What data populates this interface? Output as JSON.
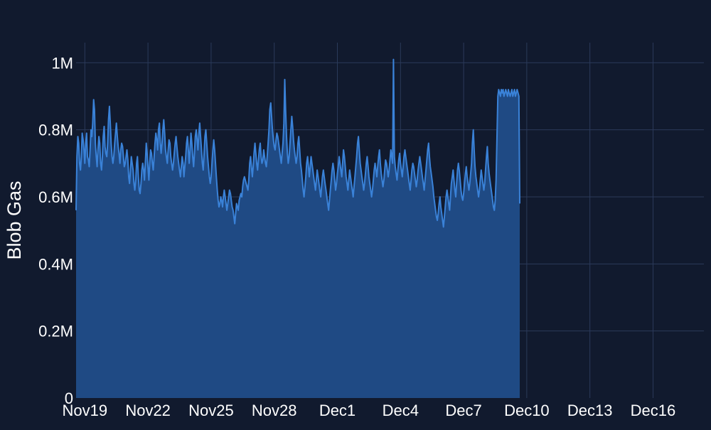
{
  "chart_data": {
    "type": "area",
    "title": "",
    "xlabel": "",
    "ylabel": "Blob Gas",
    "x_tick_labels": [
      "Nov19",
      "Nov22",
      "Nov25",
      "Nov28",
      "Dec1",
      "Dec4",
      "Dec7",
      "Dec10",
      "Dec13",
      "Dec16"
    ],
    "y_tick_labels": [
      "0",
      "0.2M",
      "0.4M",
      "0.6M",
      "0.8M",
      "1M"
    ],
    "y_ticks": [
      0,
      200000,
      400000,
      600000,
      800000,
      1000000
    ],
    "xlim": [
      "Nov18 14:00",
      "Dec18 10:00"
    ],
    "ylim": [
      0,
      1060000
    ],
    "grid": true,
    "colors": {
      "background": "#111a2e",
      "grid": "#2b3a5a",
      "line": "#3a82d8",
      "fill": "#1f4a84"
    },
    "series": [
      {
        "x_start": "Nov18 14:00",
        "x_step_hours": 1,
        "values": [
          560000,
          720000,
          780000,
          760000,
          700000,
          680000,
          720000,
          790000,
          770000,
          740000,
          700000,
          760000,
          790000,
          720000,
          710000,
          690000,
          740000,
          800000,
          780000,
          820000,
          890000,
          860000,
          760000,
          720000,
          690000,
          740000,
          780000,
          760000,
          700000,
          680000,
          720000,
          780000,
          810000,
          750000,
          730000,
          720000,
          760000,
          830000,
          870000,
          820000,
          760000,
          720000,
          700000,
          720000,
          760000,
          790000,
          820000,
          780000,
          750000,
          730000,
          700000,
          740000,
          760000,
          750000,
          720000,
          690000,
          700000,
          720000,
          740000,
          710000,
          660000,
          640000,
          680000,
          720000,
          700000,
          680000,
          640000,
          620000,
          650000,
          700000,
          720000,
          660000,
          620000,
          610000,
          640000,
          680000,
          700000,
          680000,
          650000,
          700000,
          760000,
          730000,
          690000,
          650000,
          700000,
          740000,
          730000,
          700000,
          680000,
          720000,
          760000,
          790000,
          770000,
          740000,
          800000,
          820000,
          760000,
          730000,
          760000,
          800000,
          830000,
          790000,
          740000,
          720000,
          700000,
          740000,
          770000,
          760000,
          720000,
          700000,
          680000,
          700000,
          730000,
          760000,
          780000,
          750000,
          720000,
          700000,
          680000,
          660000,
          690000,
          720000,
          700000,
          660000,
          690000,
          720000,
          760000,
          780000,
          740000,
          700000,
          740000,
          790000,
          760000,
          720000,
          690000,
          730000,
          780000,
          800000,
          770000,
          740000,
          790000,
          820000,
          780000,
          740000,
          700000,
          680000,
          730000,
          780000,
          800000,
          760000,
          720000,
          690000,
          660000,
          640000,
          660000,
          700000,
          740000,
          770000,
          740000,
          700000,
          660000,
          620000,
          590000,
          570000,
          580000,
          600000,
          590000,
          570000,
          600000,
          620000,
          600000,
          580000,
          560000,
          580000,
          600000,
          620000,
          610000,
          590000,
          570000,
          560000,
          540000,
          520000,
          550000,
          580000,
          570000,
          560000,
          590000,
          600000,
          610000,
          600000,
          630000,
          650000,
          660000,
          650000,
          640000,
          630000,
          620000,
          650000,
          700000,
          720000,
          690000,
          660000,
          690000,
          730000,
          760000,
          730000,
          700000,
          680000,
          710000,
          740000,
          760000,
          720000,
          700000,
          710000,
          740000,
          720000,
          700000,
          690000,
          720000,
          760000,
          800000,
          860000,
          880000,
          840000,
          800000,
          770000,
          750000,
          740000,
          770000,
          790000,
          780000,
          760000,
          740000,
          720000,
          700000,
          730000,
          760000,
          820000,
          950000,
          860000,
          780000,
          730000,
          700000,
          720000,
          760000,
          800000,
          840000,
          810000,
          770000,
          740000,
          720000,
          700000,
          720000,
          760000,
          780000,
          740000,
          700000,
          680000,
          650000,
          620000,
          600000,
          630000,
          660000,
          700000,
          720000,
          690000,
          660000,
          690000,
          720000,
          700000,
          680000,
          660000,
          640000,
          620000,
          650000,
          680000,
          660000,
          640000,
          620000,
          600000,
          630000,
          660000,
          680000,
          660000,
          640000,
          620000,
          600000,
          580000,
          560000,
          590000,
          620000,
          650000,
          680000,
          700000,
          680000,
          650000,
          620000,
          640000,
          670000,
          690000,
          720000,
          700000,
          680000,
          660000,
          700000,
          740000,
          720000,
          690000,
          660000,
          640000,
          620000,
          650000,
          680000,
          660000,
          640000,
          620000,
          600000,
          630000,
          660000,
          690000,
          720000,
          760000,
          780000,
          740000,
          700000,
          680000,
          660000,
          640000,
          620000,
          640000,
          670000,
          700000,
          720000,
          690000,
          660000,
          640000,
          620000,
          600000,
          620000,
          650000,
          680000,
          700000,
          680000,
          660000,
          690000,
          720000,
          740000,
          700000,
          670000,
          650000,
          630000,
          650000,
          680000,
          710000,
          700000,
          680000,
          660000,
          680000,
          710000,
          740000,
          720000,
          700000,
          1010000,
          720000,
          690000,
          670000,
          650000,
          680000,
          710000,
          730000,
          700000,
          680000,
          660000,
          690000,
          720000,
          740000,
          720000,
          700000,
          680000,
          660000,
          640000,
          620000,
          650000,
          680000,
          700000,
          690000,
          670000,
          650000,
          630000,
          650000,
          680000,
          700000,
          720000,
          700000,
          680000,
          660000,
          640000,
          620000,
          650000,
          680000,
          710000,
          740000,
          760000,
          720000,
          690000,
          670000,
          650000,
          630000,
          600000,
          580000,
          560000,
          540000,
          530000,
          550000,
          580000,
          600000,
          570000,
          550000,
          530000,
          510000,
          540000,
          570000,
          600000,
          620000,
          600000,
          580000,
          560000,
          600000,
          640000,
          660000,
          680000,
          650000,
          620000,
          600000,
          640000,
          680000,
          700000,
          680000,
          650000,
          620000,
          600000,
          590000,
          610000,
          640000,
          670000,
          690000,
          660000,
          640000,
          620000,
          640000,
          670000,
          700000,
          760000,
          800000,
          740000,
          690000,
          660000,
          640000,
          620000,
          600000,
          620000,
          650000,
          680000,
          660000,
          640000,
          620000,
          640000,
          680000,
          720000,
          750000,
          700000,
          670000,
          650000,
          630000,
          610000,
          590000,
          570000,
          560000,
          590000,
          650000,
          780000,
          900000,
          920000,
          910000,
          900000,
          920000,
          910000,
          920000,
          900000,
          910000,
          920000,
          910000,
          900000,
          920000,
          910000,
          900000,
          910000,
          920000,
          900000,
          910000,
          920000,
          900000,
          910000,
          920000,
          910000,
          900000,
          580000
        ]
      }
    ]
  }
}
